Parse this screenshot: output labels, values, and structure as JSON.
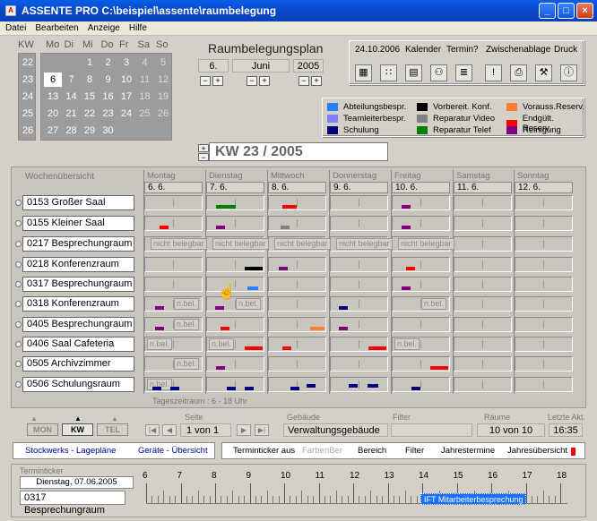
{
  "window": {
    "title": "ASSENTE PRO   C:\\beispiel\\assente\\raumbelegung"
  },
  "menu": [
    "Datei",
    "Bearbeiten",
    "Anzeige",
    "Hilfe"
  ],
  "calendar": {
    "kw_header": "KW",
    "day_headers": [
      "Mo",
      "Di",
      "Mi",
      "Do",
      "Fr",
      "Sa",
      "So"
    ],
    "weeks": [
      {
        "kw": "22",
        "days": [
          "",
          "",
          "1",
          "2",
          "3",
          "4",
          "5"
        ]
      },
      {
        "kw": "23",
        "days": [
          "6",
          "7",
          "8",
          "9",
          "10",
          "11",
          "12"
        ]
      },
      {
        "kw": "24",
        "days": [
          "13",
          "14",
          "15",
          "16",
          "17",
          "18",
          "19"
        ]
      },
      {
        "kw": "25",
        "days": [
          "20",
          "21",
          "22",
          "23",
          "24",
          "25",
          "26"
        ]
      },
      {
        "kw": "26",
        "days": [
          "27",
          "28",
          "29",
          "30",
          "",
          "",
          ""
        ]
      }
    ]
  },
  "plan": {
    "title": "Raumbelegungsplan",
    "day": "6.",
    "month": "Juni",
    "year": "2005"
  },
  "toolbar": {
    "date": "24.10.2006",
    "items": [
      "Kalender",
      "Termin?",
      "Zwischenablage",
      "Druck"
    ]
  },
  "legend": [
    {
      "label": "Abteilungsbespr.",
      "color": "#2a7fff"
    },
    {
      "label": "Vorbereit. Konf.",
      "color": "#000000"
    },
    {
      "label": "Vorauss.Reserv.",
      "color": "#ff8030"
    },
    {
      "label": "Teamleiterbespr.",
      "color": "#8080ff"
    },
    {
      "label": "Reparatur Video",
      "color": "#808080"
    },
    {
      "label": "Endgült. Reserv.",
      "color": "#ff0000"
    },
    {
      "label": "Schulung",
      "color": "#000080"
    },
    {
      "label": "Reparatur Telef",
      "color": "#008000"
    },
    {
      "label": "Reinigung",
      "color": "#800080"
    }
  ],
  "week_label": "KW 23 / 2005",
  "week_overview": "Wochenübersicht",
  "days": [
    {
      "name": "Montag",
      "date": "6. 6."
    },
    {
      "name": "Dienstag",
      "date": "7. 6."
    },
    {
      "name": "Mittwoch",
      "date": "8. 6."
    },
    {
      "name": "Donnerstag",
      "date": "9. 6."
    },
    {
      "name": "Freitag",
      "date": "10. 6."
    },
    {
      "name": "Samstag",
      "date": "11. 6."
    },
    {
      "name": "Sonntag",
      "date": "12. 6."
    }
  ],
  "rooms": [
    "0153 Großer Saal",
    "0155 Kleiner Saal",
    "0217 Besprechungraum",
    "0218 Konferenzraum",
    "0317 Besprechungraum",
    "0318 Konferenzraum",
    "0405 Besprechungraum",
    "0406 Saal Cafeteria",
    "0505 Archivzimmer",
    "0506 Schulungsraum"
  ],
  "not_available": "nicht belegbar",
  "nbel": "n.bel.",
  "timespan": "Tageszeitraum :  6 - 18 Uhr",
  "nav": {
    "mon": "MON",
    "kw": "KW",
    "tel": "TEL"
  },
  "page": {
    "label": "Seite",
    "value": "1 von 1"
  },
  "building": {
    "label": "Gebäude",
    "value": "Verwaltungsgebäude"
  },
  "filter": {
    "label": "Filter",
    "value": ""
  },
  "rooms_count": {
    "label": "Räume",
    "value": "10 von 10"
  },
  "last_update": {
    "label": "Letzte Akt.",
    "value": "16:35"
  },
  "links": [
    "Stockwerks - Lagepläne",
    "Geräte - Übersicht"
  ],
  "bottom_bar": [
    "Terminticker aus",
    "FarbenBer",
    "Bereich",
    "Filter",
    "Jahrestermine",
    "Jahresübersicht"
  ],
  "ticker": {
    "label": "Terminticker",
    "date": "Dienstag, 07.06.2005",
    "room": "0317 Besprechungraum",
    "hours": [
      "6",
      "7",
      "8",
      "9",
      "10",
      "11",
      "12",
      "13",
      "14",
      "15",
      "16",
      "17",
      "18"
    ],
    "event": "IFT Mitarbeiterbesprechung"
  }
}
